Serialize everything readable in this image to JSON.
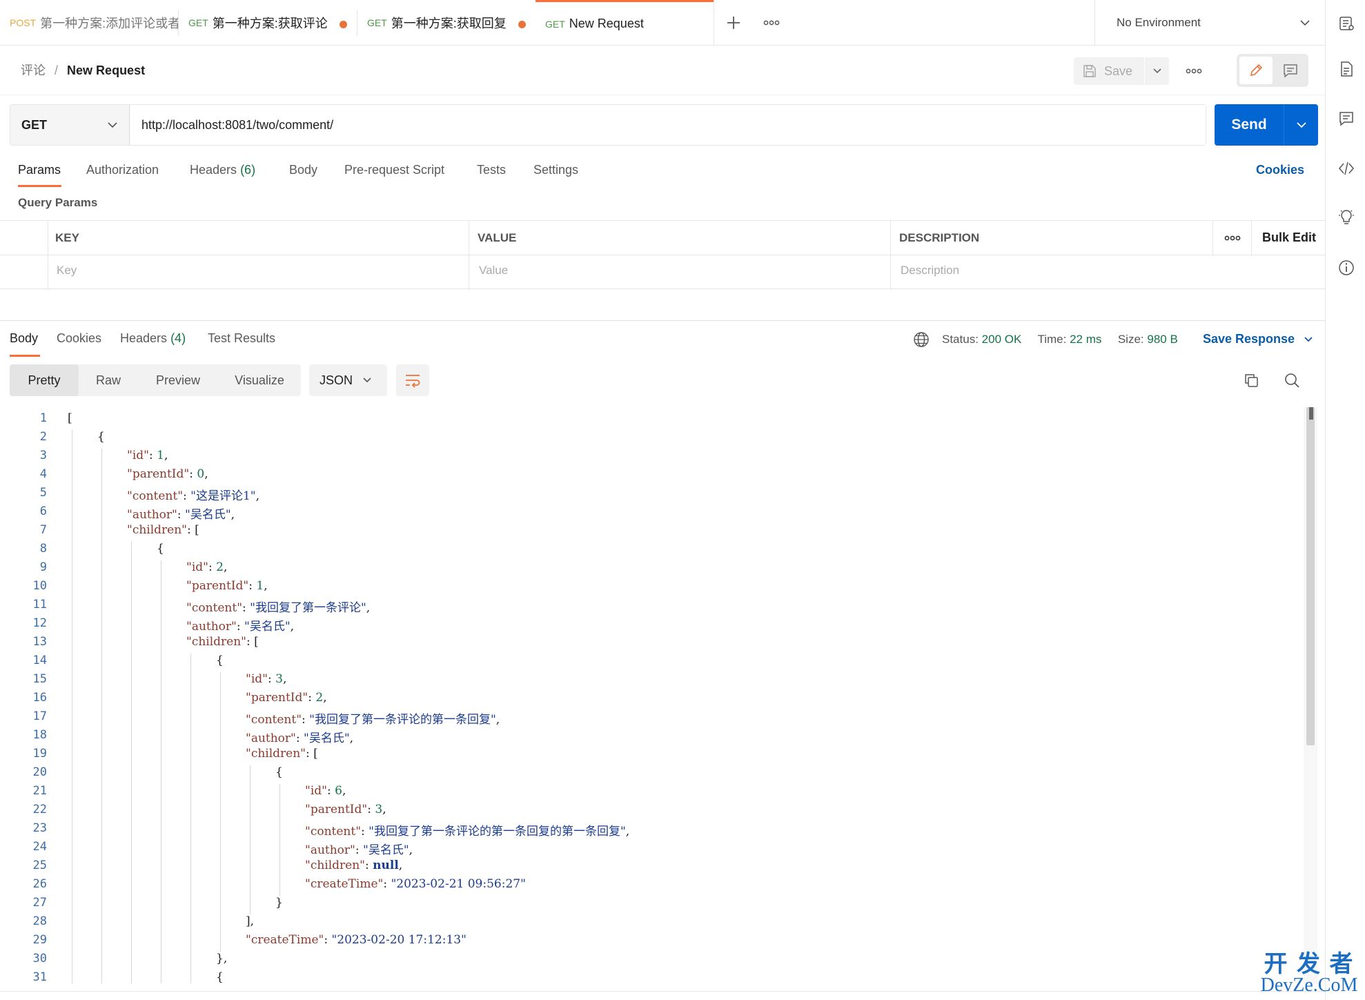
{
  "tabs": [
    {
      "method": "POST",
      "name": "第一种方案:添加评论或者",
      "dot": false
    },
    {
      "method": "GET",
      "name": "第一种方案:获取评论",
      "dot": true
    },
    {
      "method": "GET",
      "name": "第一种方案:获取回复",
      "dot": true
    },
    {
      "method": "GET",
      "name": "New Request",
      "dot": false
    }
  ],
  "environment": "No Environment",
  "breadcrumb": {
    "parent": "评论",
    "separator": "/",
    "current": "New Request"
  },
  "save_label": "Save",
  "request": {
    "method": "GET",
    "url": "http://localhost:8081/two/comment/"
  },
  "send_label": "Send",
  "request_tabs": {
    "params": "Params",
    "authorization": "Authorization",
    "headers": "Headers",
    "headers_count": "(6)",
    "body": "Body",
    "prerequest": "Pre-request Script",
    "tests": "Tests",
    "settings": "Settings",
    "cookies": "Cookies"
  },
  "query_params_label": "Query Params",
  "params_table": {
    "headers": [
      "KEY",
      "VALUE",
      "DESCRIPTION"
    ],
    "bulk_edit": "Bulk Edit",
    "placeholders": [
      "Key",
      "Value",
      "Description"
    ]
  },
  "response_tabs": {
    "body": "Body",
    "cookies": "Cookies",
    "headers": "Headers",
    "headers_count": "(4)",
    "test_results": "Test Results"
  },
  "status": {
    "status_label": "Status:",
    "status_value": "200 OK",
    "time_label": "Time:",
    "time_value": "22 ms",
    "size_label": "Size:",
    "size_value": "980 B"
  },
  "save_response": "Save Response",
  "view_modes": [
    "Pretty",
    "Raw",
    "Preview",
    "Visualize"
  ],
  "format": "JSON",
  "code_lines": [
    {
      "indent": 0,
      "parts": [
        [
          "p",
          "["
        ]
      ]
    },
    {
      "indent": 1,
      "parts": [
        [
          "p",
          "{"
        ]
      ]
    },
    {
      "indent": 2,
      "parts": [
        [
          "k",
          "\"id\""
        ],
        [
          "p",
          ": "
        ],
        [
          "n",
          "1"
        ],
        [
          "p",
          ","
        ]
      ]
    },
    {
      "indent": 2,
      "parts": [
        [
          "k",
          "\"parentId\""
        ],
        [
          "p",
          ": "
        ],
        [
          "n",
          "0"
        ],
        [
          "p",
          ","
        ]
      ]
    },
    {
      "indent": 2,
      "parts": [
        [
          "k",
          "\"content\""
        ],
        [
          "p",
          ": "
        ],
        [
          "s",
          "\"这是评论1\""
        ],
        [
          "p",
          ","
        ]
      ]
    },
    {
      "indent": 2,
      "parts": [
        [
          "k",
          "\"author\""
        ],
        [
          "p",
          ": "
        ],
        [
          "s",
          "\"吴名氏\""
        ],
        [
          "p",
          ","
        ]
      ]
    },
    {
      "indent": 2,
      "parts": [
        [
          "k",
          "\"children\""
        ],
        [
          "p",
          ": ["
        ]
      ]
    },
    {
      "indent": 3,
      "parts": [
        [
          "p",
          "{"
        ]
      ]
    },
    {
      "indent": 4,
      "parts": [
        [
          "k",
          "\"id\""
        ],
        [
          "p",
          ": "
        ],
        [
          "n",
          "2"
        ],
        [
          "p",
          ","
        ]
      ]
    },
    {
      "indent": 4,
      "parts": [
        [
          "k",
          "\"parentId\""
        ],
        [
          "p",
          ": "
        ],
        [
          "n",
          "1"
        ],
        [
          "p",
          ","
        ]
      ]
    },
    {
      "indent": 4,
      "parts": [
        [
          "k",
          "\"content\""
        ],
        [
          "p",
          ": "
        ],
        [
          "s",
          "\"我回复了第一条评论\""
        ],
        [
          "p",
          ","
        ]
      ]
    },
    {
      "indent": 4,
      "parts": [
        [
          "k",
          "\"author\""
        ],
        [
          "p",
          ": "
        ],
        [
          "s",
          "\"吴名氏\""
        ],
        [
          "p",
          ","
        ]
      ]
    },
    {
      "indent": 4,
      "parts": [
        [
          "k",
          "\"children\""
        ],
        [
          "p",
          ": ["
        ]
      ]
    },
    {
      "indent": 5,
      "parts": [
        [
          "p",
          "{"
        ]
      ]
    },
    {
      "indent": 6,
      "parts": [
        [
          "k",
          "\"id\""
        ],
        [
          "p",
          ": "
        ],
        [
          "n",
          "3"
        ],
        [
          "p",
          ","
        ]
      ]
    },
    {
      "indent": 6,
      "parts": [
        [
          "k",
          "\"parentId\""
        ],
        [
          "p",
          ": "
        ],
        [
          "n",
          "2"
        ],
        [
          "p",
          ","
        ]
      ]
    },
    {
      "indent": 6,
      "parts": [
        [
          "k",
          "\"content\""
        ],
        [
          "p",
          ": "
        ],
        [
          "s",
          "\"我回复了第一条评论的第一条回复\""
        ],
        [
          "p",
          ","
        ]
      ]
    },
    {
      "indent": 6,
      "parts": [
        [
          "k",
          "\"author\""
        ],
        [
          "p",
          ": "
        ],
        [
          "s",
          "\"吴名氏\""
        ],
        [
          "p",
          ","
        ]
      ]
    },
    {
      "indent": 6,
      "parts": [
        [
          "k",
          "\"children\""
        ],
        [
          "p",
          ": ["
        ]
      ]
    },
    {
      "indent": 7,
      "parts": [
        [
          "p",
          "{"
        ]
      ]
    },
    {
      "indent": 8,
      "parts": [
        [
          "k",
          "\"id\""
        ],
        [
          "p",
          ": "
        ],
        [
          "n",
          "6"
        ],
        [
          "p",
          ","
        ]
      ]
    },
    {
      "indent": 8,
      "parts": [
        [
          "k",
          "\"parentId\""
        ],
        [
          "p",
          ": "
        ],
        [
          "n",
          "3"
        ],
        [
          "p",
          ","
        ]
      ]
    },
    {
      "indent": 8,
      "parts": [
        [
          "k",
          "\"content\""
        ],
        [
          "p",
          ": "
        ],
        [
          "s",
          "\"我回复了第一条评论的第一条回复的第一条回复\""
        ],
        [
          "p",
          ","
        ]
      ]
    },
    {
      "indent": 8,
      "parts": [
        [
          "k",
          "\"author\""
        ],
        [
          "p",
          ": "
        ],
        [
          "s",
          "\"吴名氏\""
        ],
        [
          "p",
          ","
        ]
      ]
    },
    {
      "indent": 8,
      "parts": [
        [
          "k",
          "\"children\""
        ],
        [
          "p",
          ": "
        ],
        [
          "nl",
          "null"
        ],
        [
          "p",
          ","
        ]
      ]
    },
    {
      "indent": 8,
      "parts": [
        [
          "k",
          "\"createTime\""
        ],
        [
          "p",
          ": "
        ],
        [
          "s",
          "\"2023-02-21 09:56:27\""
        ]
      ]
    },
    {
      "indent": 7,
      "parts": [
        [
          "p",
          "}"
        ]
      ]
    },
    {
      "indent": 6,
      "parts": [
        [
          "p",
          "],"
        ]
      ]
    },
    {
      "indent": 6,
      "parts": [
        [
          "k",
          "\"createTime\""
        ],
        [
          "p",
          ": "
        ],
        [
          "s",
          "\"2023-02-20 17:12:13\""
        ]
      ]
    },
    {
      "indent": 5,
      "parts": [
        [
          "p",
          "},"
        ]
      ]
    },
    {
      "indent": 5,
      "parts": [
        [
          "p",
          "{"
        ]
      ]
    }
  ],
  "watermark": {
    "line1": "开 发 者",
    "line2": "DevZe.CoM"
  },
  "colors": {
    "accent": "#ff6c37",
    "send": "#0265d2",
    "link": "#0b5ca8",
    "status_ok": "#157347"
  }
}
